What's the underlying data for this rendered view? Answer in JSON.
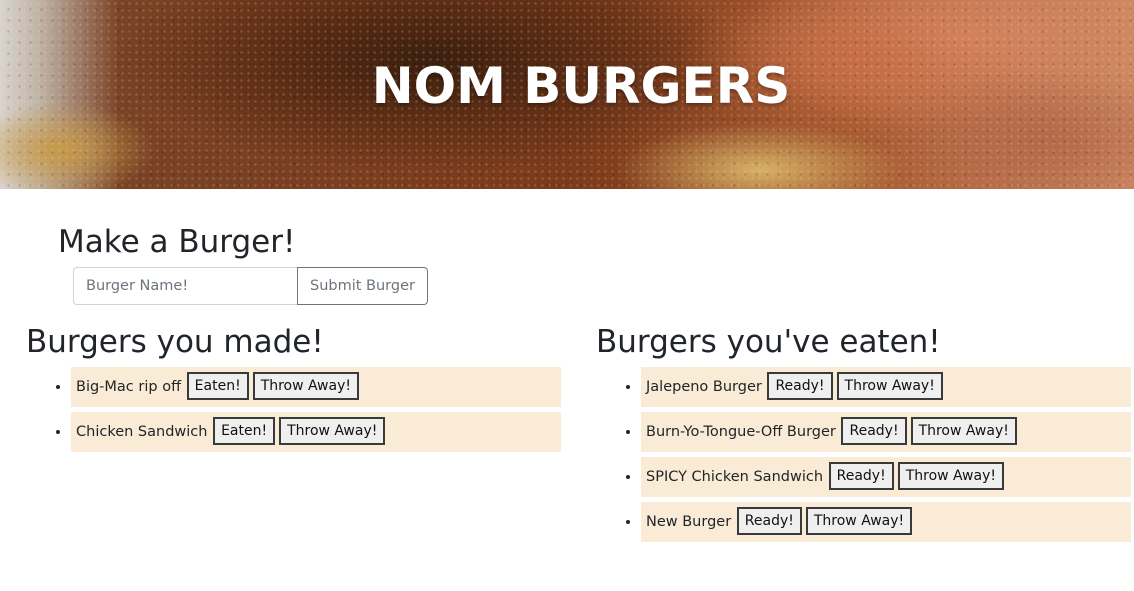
{
  "header": {
    "title": "NOM BURGERS"
  },
  "form": {
    "heading": "Make a Burger!",
    "input_placeholder": "Burger Name!",
    "input_value": "",
    "submit_label": "Submit Burger"
  },
  "made": {
    "heading": "Burgers you made!",
    "items": [
      {
        "name": "Big-Mac rip off",
        "primary_label": "Eaten!",
        "secondary_label": "Throw Away!"
      },
      {
        "name": "Chicken Sandwich",
        "primary_label": "Eaten!",
        "secondary_label": "Throw Away!"
      }
    ]
  },
  "eaten": {
    "heading": "Burgers you've eaten!",
    "items": [
      {
        "name": "Jalepeno Burger",
        "primary_label": "Ready!",
        "secondary_label": "Throw Away!"
      },
      {
        "name": "Burn-Yo-Tongue-Off Burger",
        "primary_label": "Ready!",
        "secondary_label": "Throw Away!"
      },
      {
        "name": "SPICY Chicken Sandwich",
        "primary_label": "Ready!",
        "secondary_label": "Throw Away!"
      },
      {
        "name": "New Burger",
        "primary_label": "Ready!",
        "secondary_label": "Throw Away!"
      }
    ]
  },
  "colors": {
    "item_background": "#faebd7",
    "text": "#212529",
    "submit_border": "#6c757d"
  }
}
